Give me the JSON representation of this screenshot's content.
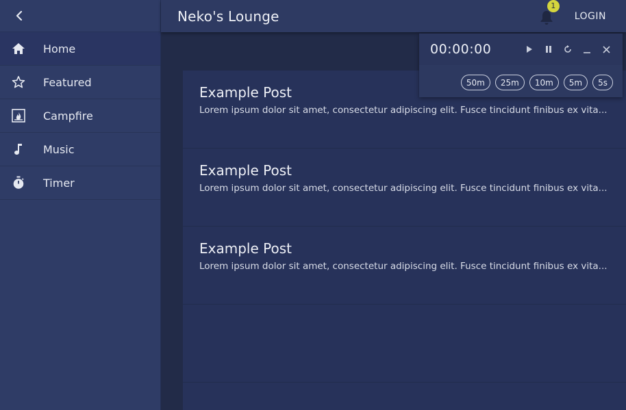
{
  "header": {
    "title": "Neko's Lounge",
    "login_label": "LOGIN",
    "notification_count": "1"
  },
  "sidebar": {
    "items": [
      {
        "label": "Home",
        "icon": "home-icon"
      },
      {
        "label": "Featured",
        "icon": "star-icon"
      },
      {
        "label": "Campfire",
        "icon": "campfire-icon"
      },
      {
        "label": "Music",
        "icon": "music-note-icon"
      },
      {
        "label": "Timer",
        "icon": "stopwatch-icon"
      }
    ]
  },
  "posts": [
    {
      "title": "Example Post",
      "body": "Lorem ipsum dolor sit amet, consectetur adipiscing elit. Fusce tincidunt finibus ex vita..."
    },
    {
      "title": "Example Post",
      "body": "Lorem ipsum dolor sit amet, consectetur adipiscing elit. Fusce tincidunt finibus ex vita..."
    },
    {
      "title": "Example Post",
      "body": "Lorem ipsum dolor sit amet, consectetur adipiscing elit. Fusce tincidunt finibus ex vita..."
    }
  ],
  "timer": {
    "display": "00:00:00",
    "presets": [
      "50m",
      "25m",
      "10m",
      "5m",
      "5s"
    ]
  },
  "colors": {
    "sidebar_bg": "#2f3c66",
    "topbar_bg": "#2e3a62",
    "main_bg": "#222b48",
    "card_bg": "#27325a",
    "badge": "#d5d63e"
  }
}
